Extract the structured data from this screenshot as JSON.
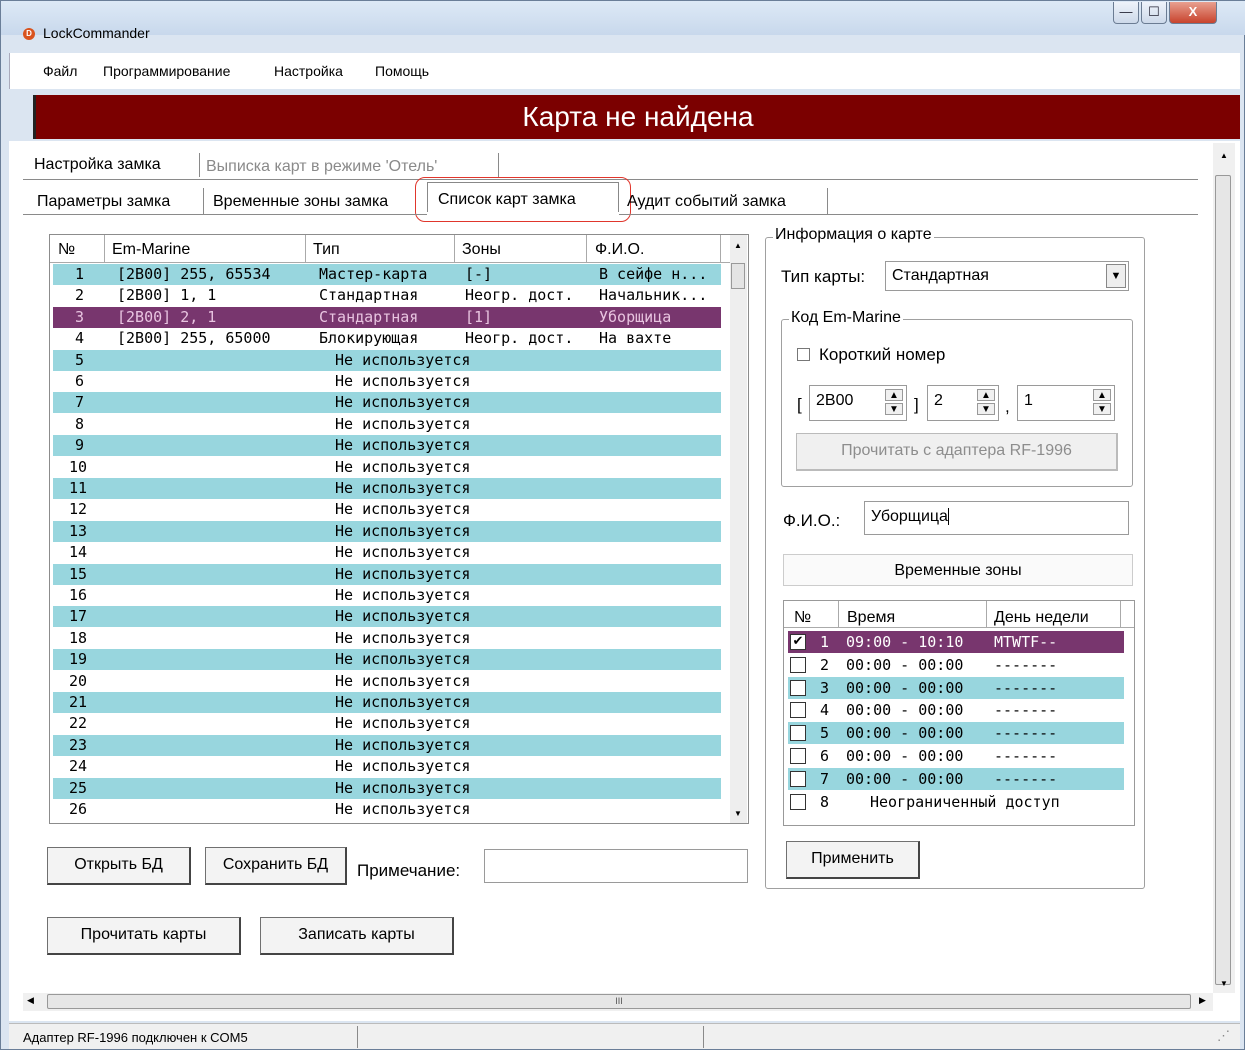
{
  "window": {
    "title": "LockCommander",
    "minimize": "—",
    "maximize": "☐",
    "close": "X"
  },
  "menu": [
    "Файл",
    "Программирование",
    "Настройка",
    "Помощь"
  ],
  "banner": "Карта не найдена",
  "tabs_top": [
    "Настройка замка",
    "Выписка карт в режиме 'Отель'"
  ],
  "tabs_sub": [
    "Параметры замка",
    "Временные зоны замка",
    "Список карт замка",
    "Аудит событий замка"
  ],
  "cards_table": {
    "headers": [
      "№",
      "Em-Marine",
      "Тип",
      "Зоны",
      "Ф.И.О."
    ],
    "rows": [
      {
        "num": "1",
        "code": "[2B00] 255, 65534",
        "type": "Мастер-карта",
        "zones": "[-]",
        "name": "В сейфе н..."
      },
      {
        "num": "2",
        "code": "[2B00] 1, 1",
        "type": "Стандартная",
        "zones": "Неогр. дост.",
        "name": "Начальник..."
      },
      {
        "num": "3",
        "code": "[2B00] 2, 1",
        "type": "Стандартная",
        "zones": "[1]",
        "name": "Уборщица"
      },
      {
        "num": "4",
        "code": "[2B00] 255, 65000",
        "type": "Блокирующая",
        "zones": "Неогр. дост.",
        "name": "На вахте"
      },
      {
        "num": "5",
        "unused": "Не используется"
      },
      {
        "num": "6",
        "unused": "Не используется"
      },
      {
        "num": "7",
        "unused": "Не используется"
      },
      {
        "num": "8",
        "unused": "Не используется"
      },
      {
        "num": "9",
        "unused": "Не используется"
      },
      {
        "num": "10",
        "unused": "Не используется"
      },
      {
        "num": "11",
        "unused": "Не используется"
      },
      {
        "num": "12",
        "unused": "Не используется"
      },
      {
        "num": "13",
        "unused": "Не используется"
      },
      {
        "num": "14",
        "unused": "Не используется"
      },
      {
        "num": "15",
        "unused": "Не используется"
      },
      {
        "num": "16",
        "unused": "Не используется"
      },
      {
        "num": "17",
        "unused": "Не используется"
      },
      {
        "num": "18",
        "unused": "Не используется"
      },
      {
        "num": "19",
        "unused": "Не используется"
      },
      {
        "num": "20",
        "unused": "Не используется"
      },
      {
        "num": "21",
        "unused": "Не используется"
      },
      {
        "num": "22",
        "unused": "Не используется"
      },
      {
        "num": "23",
        "unused": "Не используется"
      },
      {
        "num": "24",
        "unused": "Не используется"
      },
      {
        "num": "25",
        "unused": "Не используется"
      },
      {
        "num": "26",
        "unused": "Не используется"
      }
    ]
  },
  "buttons": {
    "open_db": "Открыть БД",
    "save_db": "Сохранить БД",
    "read_cards": "Прочитать карты",
    "write_cards": "Записать карты",
    "apply": "Применить",
    "read_adapter": "Прочитать с адаптера RF-1996",
    "time_zones": "Временные зоны"
  },
  "note_label": "Примечание:",
  "card_info": {
    "legend": "Информация о карте",
    "type_label": "Тип карты:",
    "type_value": "Стандартная",
    "em_legend": "Код Em-Marine",
    "short_number": "Короткий номер",
    "bracket_open": "[",
    "bracket_close": "]",
    "comma": ",",
    "code_prefix": "2B00",
    "code_a": "2",
    "code_b": "1",
    "fio_label": "Ф.И.О.:",
    "fio_value": "Уборщица"
  },
  "zones_table": {
    "headers": [
      "№",
      "Время",
      "День недели"
    ],
    "rows": [
      {
        "num": "1",
        "time": "09:00 - 10:10",
        "days": "MTWTF--",
        "checked": true
      },
      {
        "num": "2",
        "time": "00:00 - 00:00",
        "days": "-------",
        "checked": false
      },
      {
        "num": "3",
        "time": "00:00 - 00:00",
        "days": "-------",
        "checked": false
      },
      {
        "num": "4",
        "time": "00:00 - 00:00",
        "days": "-------",
        "checked": false
      },
      {
        "num": "5",
        "time": "00:00 - 00:00",
        "days": "-------",
        "checked": false
      },
      {
        "num": "6",
        "time": "00:00 - 00:00",
        "days": "-------",
        "checked": false
      },
      {
        "num": "7",
        "time": "00:00 - 00:00",
        "days": "-------",
        "checked": false
      },
      {
        "num": "8",
        "unlimited": "Неограниченный доступ",
        "checked": false
      }
    ]
  },
  "scroll_glyph": "III",
  "status": "Адаптер RF-1996 подключен к COM5",
  "colors": {
    "banner": "#7b0000",
    "row_alt": "#98d6de",
    "row_selected": "#78366e",
    "tab_highlight": "#e0362c"
  }
}
